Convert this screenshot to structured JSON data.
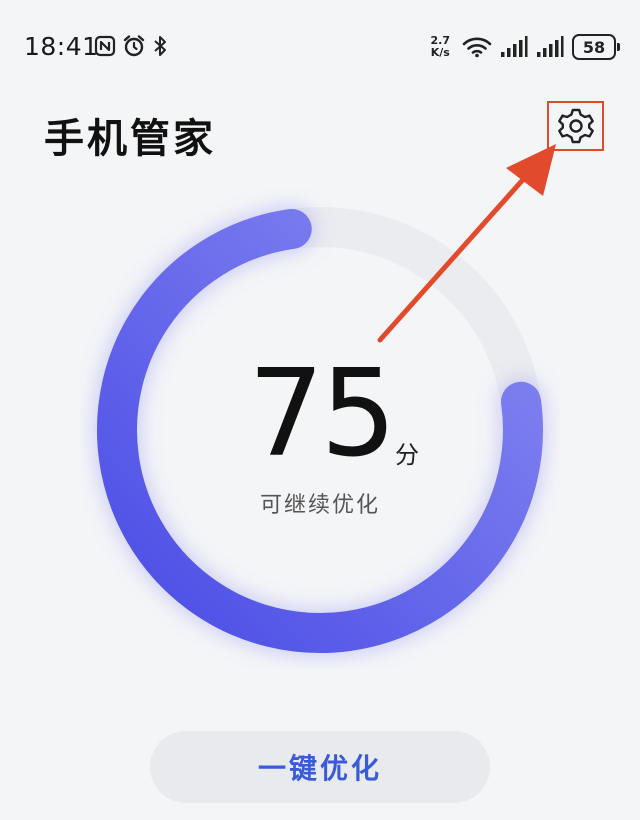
{
  "status_bar": {
    "time": "18:41",
    "left_icons": [
      "nfc-icon",
      "alarm-icon",
      "bluetooth-icon"
    ],
    "net_speed_value": "2.7",
    "net_speed_unit": "K/s",
    "right_icons": [
      "wifi-icon",
      "signal-icon-1",
      "signal-icon-2"
    ],
    "battery_level": "58"
  },
  "header": {
    "title": "手机管家",
    "settings_icon": "gear-icon"
  },
  "score": {
    "value": "75",
    "unit": "分",
    "status": "可继续优化",
    "max": 100
  },
  "optimize_button": {
    "label": "一键优化"
  },
  "colors": {
    "ring_start": "#4b4ee8",
    "ring_end": "#8487f0",
    "ring_track": "#ebecef",
    "annotation": "#e24a2c",
    "button_text": "#3a5bd9"
  }
}
